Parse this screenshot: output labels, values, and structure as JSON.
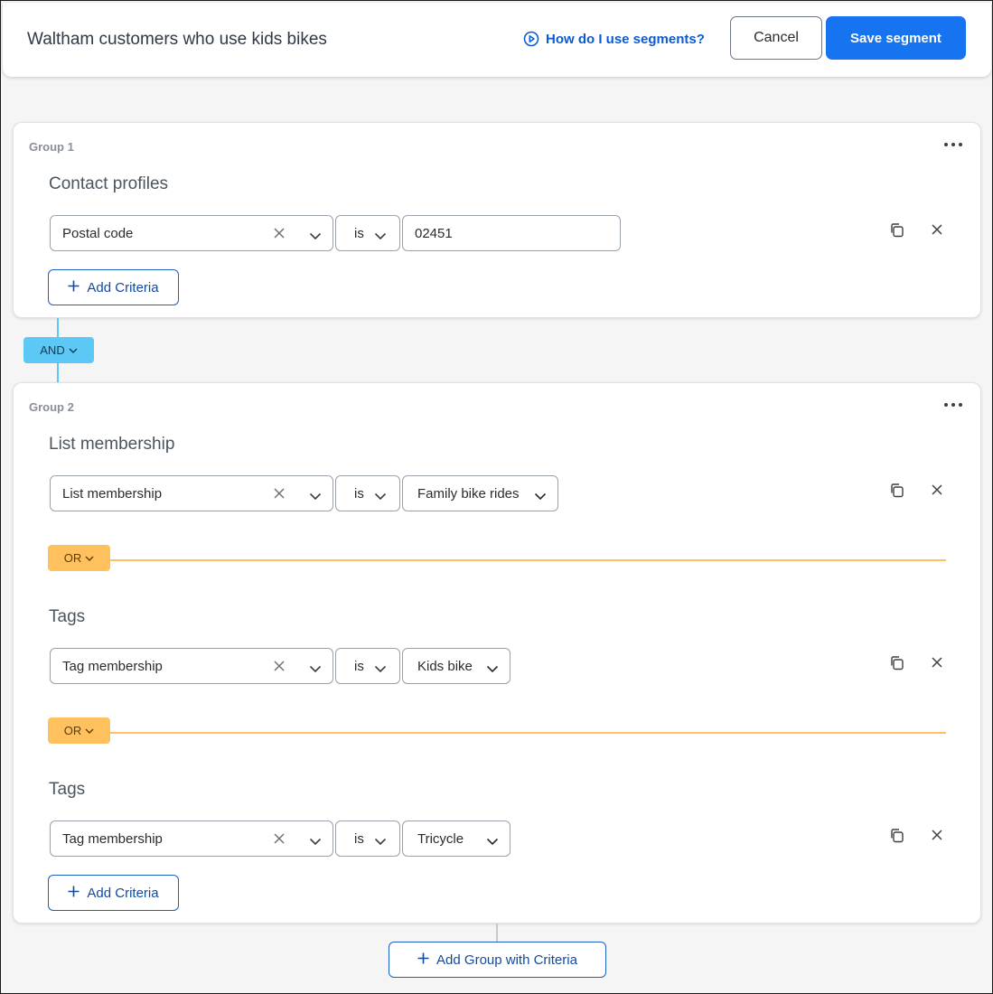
{
  "header": {
    "title": "Waltham customers who use kids bikes",
    "help_link": "How do I use segments?",
    "cancel_label": "Cancel",
    "save_label": "Save segment"
  },
  "colors": {
    "primary": "#1674f0",
    "link": "#0b5bd3",
    "and_pill": "#5bc8f5",
    "or_pill": "#ffc15e"
  },
  "groups": [
    {
      "label": "Group 1",
      "sections": [
        {
          "title": "Contact profiles",
          "criteria": {
            "field": "Postal code",
            "operator": "is",
            "value": "02451"
          }
        }
      ],
      "add_criteria_label": "Add Criteria"
    },
    {
      "label": "Group 2",
      "sections": [
        {
          "title": "List membership",
          "criteria": {
            "field": "List membership",
            "operator": "is",
            "value": "Family bike rides"
          }
        },
        {
          "title": "Tags",
          "criteria": {
            "field": "Tag membership",
            "operator": "is",
            "value": "Kids bike"
          }
        },
        {
          "title": "Tags",
          "criteria": {
            "field": "Tag membership",
            "operator": "is",
            "value": "Tricycle"
          }
        }
      ],
      "or_label": "OR",
      "add_criteria_label": "Add Criteria"
    }
  ],
  "connector": {
    "and_label": "AND"
  },
  "add_group_label": "Add Group with Criteria",
  "icons": {
    "help": "play-circle-icon",
    "more": "more-horizontal-icon",
    "clear": "close-icon",
    "dropdown": "chevron-down-icon",
    "copy": "copy-icon",
    "remove": "close-icon",
    "add": "plus-icon"
  }
}
